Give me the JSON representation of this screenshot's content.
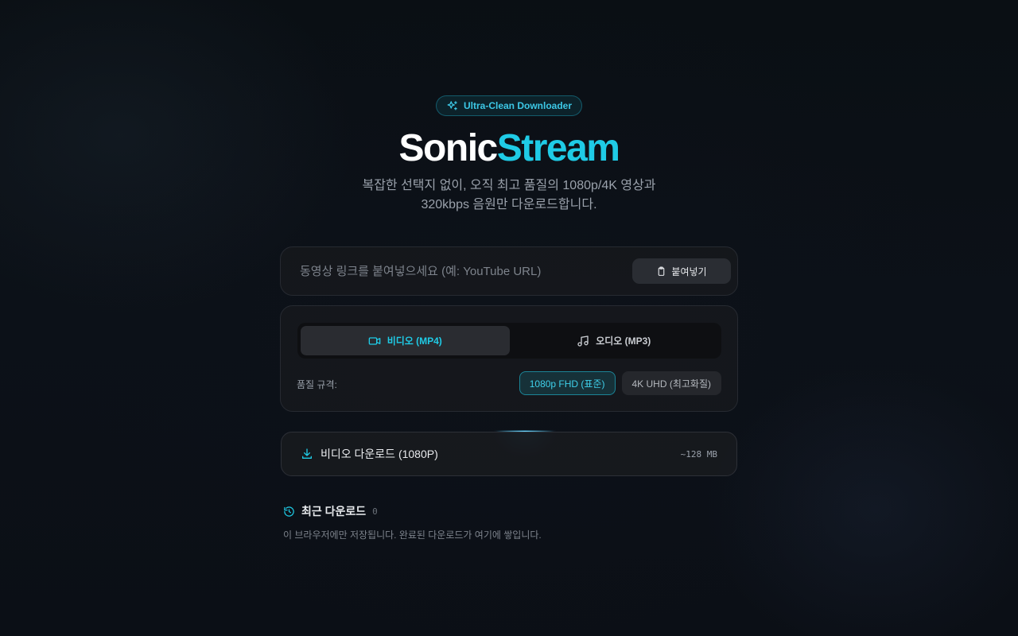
{
  "header": {
    "badge": "Ultra-Clean Downloader",
    "title_part1": "Sonic",
    "title_part2": "Stream",
    "subtitle_line1": "복잡한 선택지 없이, 오직 최고 품질의 1080p/4K 영상과",
    "subtitle_line2": "320kbps 음원만 다운로드합니다."
  },
  "url_input": {
    "placeholder": "동영상 링크를 붙여넣으세요 (예: YouTube URL)",
    "value": "",
    "paste_label": "붙여넣기"
  },
  "options": {
    "tabs": [
      {
        "label": "비디오 (MP4)",
        "active": true
      },
      {
        "label": "오디오 (MP3)",
        "active": false
      }
    ],
    "quality_label": "품질 규격:",
    "quality_options": [
      {
        "label": "1080p FHD (표준)",
        "active": true
      },
      {
        "label": "4K UHD (최고화질)",
        "active": false
      }
    ]
  },
  "download": {
    "label": "비디오 다운로드 (1080P)",
    "size": "~128 MB"
  },
  "recent": {
    "title": "최근 다운로드",
    "count": "0",
    "note": "이 브라우저에만 저장됩니다. 완료된 다운로드가 여기에 쌓입니다."
  },
  "colors": {
    "accent": "#1fcbe6",
    "background": "#0b0e13",
    "panel": "#16181c"
  },
  "icons": {
    "badge": "sparkles-icon",
    "paste": "clipboard-icon",
    "video_tab": "video-camera-icon",
    "audio_tab": "music-note-icon",
    "download": "download-icon",
    "recent": "history-icon"
  }
}
